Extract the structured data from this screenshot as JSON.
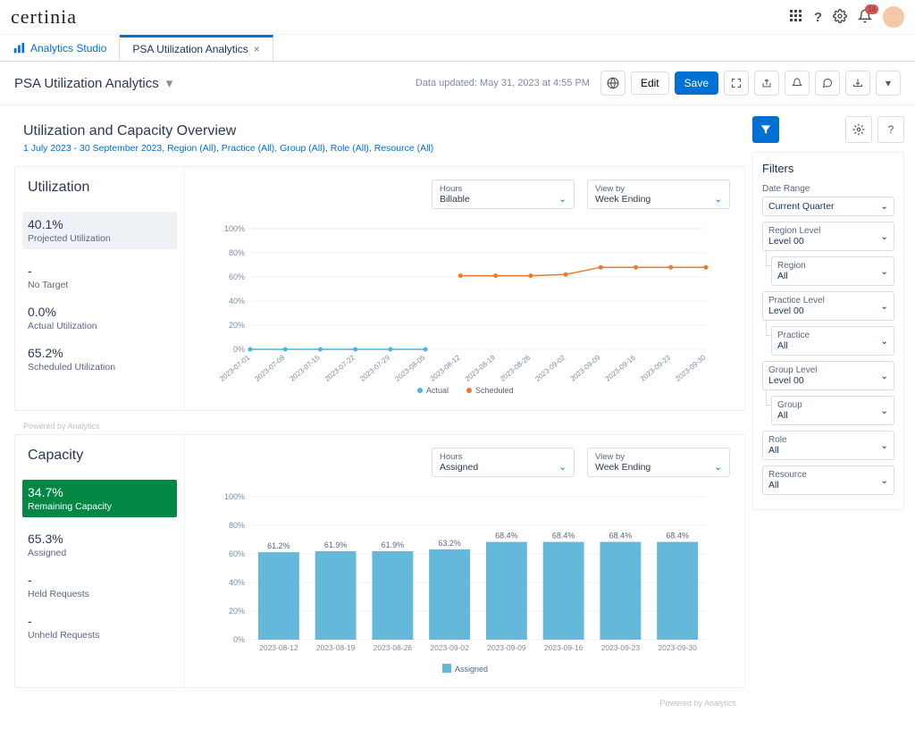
{
  "brand": "certinia",
  "top_icons": {
    "notification_count": "14"
  },
  "tabs": {
    "studio": "Analytics Studio",
    "active": "PSA Utilization Analytics"
  },
  "page": {
    "title": "PSA Utilization Analytics",
    "updated": "Data updated: May 31, 2023 at 4:55 PM",
    "edit": "Edit",
    "save": "Save"
  },
  "section": {
    "title": "Utilization and Capacity Overview",
    "filters": "1 July 2023 - 30 September 2023, Region (All), Practice (All), Group (All), Role (All), Resource (All)"
  },
  "utilization": {
    "title": "Utilization",
    "projected_val": "40.1%",
    "projected_lbl": "Projected Utilization",
    "target_val": "-",
    "target_lbl": "No Target",
    "actual_val": "0.0%",
    "actual_lbl": "Actual Utilization",
    "scheduled_val": "65.2%",
    "scheduled_lbl": "Scheduled Utilization",
    "hours_lbl": "Hours",
    "hours_val": "Billable",
    "view_lbl": "View by",
    "view_val": "Week Ending",
    "legend_actual": "Actual",
    "legend_scheduled": "Scheduled",
    "powered": "Powered by Analytics"
  },
  "capacity": {
    "title": "Capacity",
    "remaining_val": "34.7%",
    "remaining_lbl": "Remaining Capacity",
    "assigned_val": "65.3%",
    "assigned_lbl": "Assigned",
    "held_val": "-",
    "held_lbl": "Held Requests",
    "unheld_val": "-",
    "unheld_lbl": "Unheld Requests",
    "hours_lbl": "Hours",
    "hours_val": "Assigned",
    "view_lbl": "View by",
    "view_val": "Week Ending",
    "legend_assigned": "Assigned",
    "powered": "Powered by Analytics"
  },
  "filters_panel": {
    "title": "Filters",
    "date_lbl": "Date Range",
    "date_val": "Current Quarter",
    "region_level_lbl": "Region Level",
    "level00": "Level 00",
    "region_lbl": "Region",
    "all": "All",
    "practice_level_lbl": "Practice Level",
    "practice_lbl": "Practice",
    "group_level_lbl": "Group Level",
    "group_lbl": "Group",
    "role_lbl": "Role",
    "resource_lbl": "Resource"
  },
  "chart_data": [
    {
      "type": "line",
      "title": "Utilization",
      "ylabel": "%",
      "ylim": [
        0,
        100
      ],
      "ticks": [
        "0%",
        "20%",
        "40%",
        "60%",
        "80%",
        "100%"
      ],
      "categories": [
        "2023-07-01",
        "2023-07-08",
        "2023-07-15",
        "2023-07-22",
        "2023-07-29",
        "2023-08-05",
        "2023-08-12",
        "2023-08-19",
        "2023-08-26",
        "2023-09-02",
        "2023-09-09",
        "2023-09-16",
        "2023-09-23",
        "2023-09-30"
      ],
      "series": [
        {
          "name": "Actual",
          "color": "#4cb3e6",
          "values": [
            0,
            0,
            0,
            0,
            0,
            0,
            null,
            null,
            null,
            null,
            null,
            null,
            null,
            null
          ]
        },
        {
          "name": "Scheduled",
          "color": "#e87b2d",
          "values": [
            null,
            null,
            null,
            null,
            null,
            null,
            61,
            61,
            61,
            62,
            68,
            68,
            68,
            68
          ]
        }
      ]
    },
    {
      "type": "bar",
      "title": "Capacity",
      "ylabel": "%",
      "ylim": [
        0,
        100
      ],
      "ticks": [
        "0%",
        "20%",
        "40%",
        "60%",
        "80%",
        "100%"
      ],
      "categories": [
        "2023-08-12",
        "2023-08-19",
        "2023-08-26",
        "2023-09-02",
        "2023-09-09",
        "2023-09-16",
        "2023-09-23",
        "2023-09-30"
      ],
      "series": [
        {
          "name": "Assigned",
          "color": "#64b9da",
          "values": [
            61.2,
            61.9,
            61.9,
            63.2,
            68.4,
            68.4,
            68.4,
            68.4
          ],
          "labels": [
            "61.2%",
            "61.9%",
            "61.9%",
            "63.2%",
            "68.4%",
            "68.4%",
            "68.4%",
            "68.4%"
          ]
        }
      ]
    }
  ]
}
